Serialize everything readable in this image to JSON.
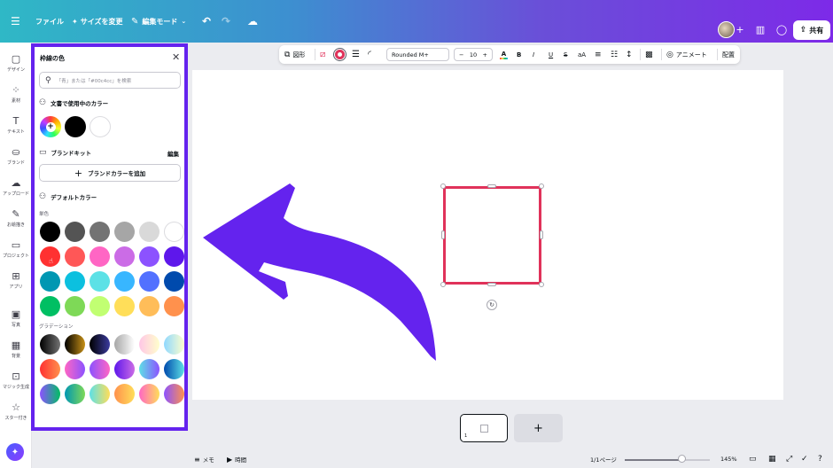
{
  "topbar": {
    "menu_icon": "hamburger-icon",
    "file": "ファイル",
    "resize": "サイズを変更",
    "edit_mode": "編集モード",
    "share": "共有"
  },
  "rail": [
    {
      "name": "design",
      "icon": "layout-icon",
      "label": "デザイン"
    },
    {
      "name": "elements",
      "icon": "shapes-icon",
      "label": "素材"
    },
    {
      "name": "text",
      "icon": "text-icon",
      "label": "テキスト"
    },
    {
      "name": "brand",
      "icon": "brand-icon",
      "label": "ブランド"
    },
    {
      "name": "uploads",
      "icon": "cloud-upload-icon",
      "label": "アップロード"
    },
    {
      "name": "draw",
      "icon": "pen-icon",
      "label": "お絵描き"
    },
    {
      "name": "projects",
      "icon": "folder-icon",
      "label": "プロジェクト"
    },
    {
      "name": "apps",
      "icon": "apps-icon",
      "label": "アプリ"
    },
    {
      "name": "photos",
      "icon": "image-icon",
      "label": "写真"
    },
    {
      "name": "background",
      "icon": "grid-icon",
      "label": "背景"
    },
    {
      "name": "magic",
      "icon": "magic-icon",
      "label": "マジック生成"
    },
    {
      "name": "starred",
      "icon": "star-icon",
      "label": "スター付き"
    }
  ],
  "panel": {
    "title": "枠線の色",
    "search_placeholder": "「青」または「#00c4cc」を検索",
    "doc_colors_heading": "文書で使用中のカラー",
    "doc_colors": [
      "#000000",
      "#ffffff"
    ],
    "brand_kit_heading": "ブランドキット",
    "brand_kit_edit": "編集",
    "add_brand_color": "ブランドカラーを追加",
    "default_colors_heading": "デフォルトカラー",
    "solid_label": "単色",
    "solid_colors": [
      [
        "#000000",
        "#545454",
        "#737373",
        "#a6a6a6",
        "#d9d9d9",
        "#ffffff"
      ],
      [
        "#ff3131",
        "#ff5757",
        "#ff66c4",
        "#cb6ce6",
        "#8c52ff",
        "#5e17eb"
      ],
      [
        "#0097b2",
        "#0cc0df",
        "#5ce1e6",
        "#38b6ff",
        "#5271ff",
        "#004aad"
      ],
      [
        "#00bf63",
        "#7ed957",
        "#c1ff72",
        "#ffde59",
        "#ffbd59",
        "#ff914d"
      ]
    ],
    "gradient_label": "グラデーション",
    "gradient_colors": [
      [
        "linear-gradient(90deg,#000000,#737373)",
        "linear-gradient(90deg,#000000,#c89116)",
        "linear-gradient(90deg,#000000,#3b3b9e)",
        "linear-gradient(90deg,#a6a6a6,#ffffff)",
        "linear-gradient(90deg,#ffc6e6,#ffffcc)",
        "linear-gradient(90deg,#8fd8ff,#ffffcc)"
      ],
      [
        "linear-gradient(90deg,#ff3131,#ff914d)",
        "linear-gradient(90deg,#ff66c4,#8c52ff)",
        "linear-gradient(90deg,#8c52ff,#ff66c4)",
        "linear-gradient(90deg,#5e17eb,#cb6ce6)",
        "linear-gradient(90deg,#5de0e6,#8c52ff)",
        "linear-gradient(90deg,#004aad,#5de0e6)"
      ],
      [
        "linear-gradient(90deg,#8c52ff,#00bf63)",
        "linear-gradient(90deg,#0097b2,#7ed957)",
        "linear-gradient(90deg,#5de0e6,#ffde59)",
        "linear-gradient(90deg,#ff914d,#ffde59)",
        "linear-gradient(90deg,#ff66c4,#ffde59)",
        "linear-gradient(90deg,#8c52ff,#ff914d)"
      ]
    ]
  },
  "toolbar": {
    "shape": "図形",
    "font": "Rounded M+",
    "size": "10",
    "minus": "−",
    "plus": "+",
    "bold": "B",
    "italic": "I",
    "underline": "U",
    "strike": "S",
    "case": "aA",
    "animate": "アニメート",
    "position": "配置"
  },
  "canvas": {
    "shape_stroke": "#e0325a",
    "arrow_color": "#6423ee"
  },
  "pages": {
    "current_number": "1",
    "add": "+"
  },
  "bottombar": {
    "notes": "メモ",
    "timer": "時間",
    "page_count": "1/1ページ",
    "zoom": "145%",
    "zoom_fraction": 0.68
  }
}
